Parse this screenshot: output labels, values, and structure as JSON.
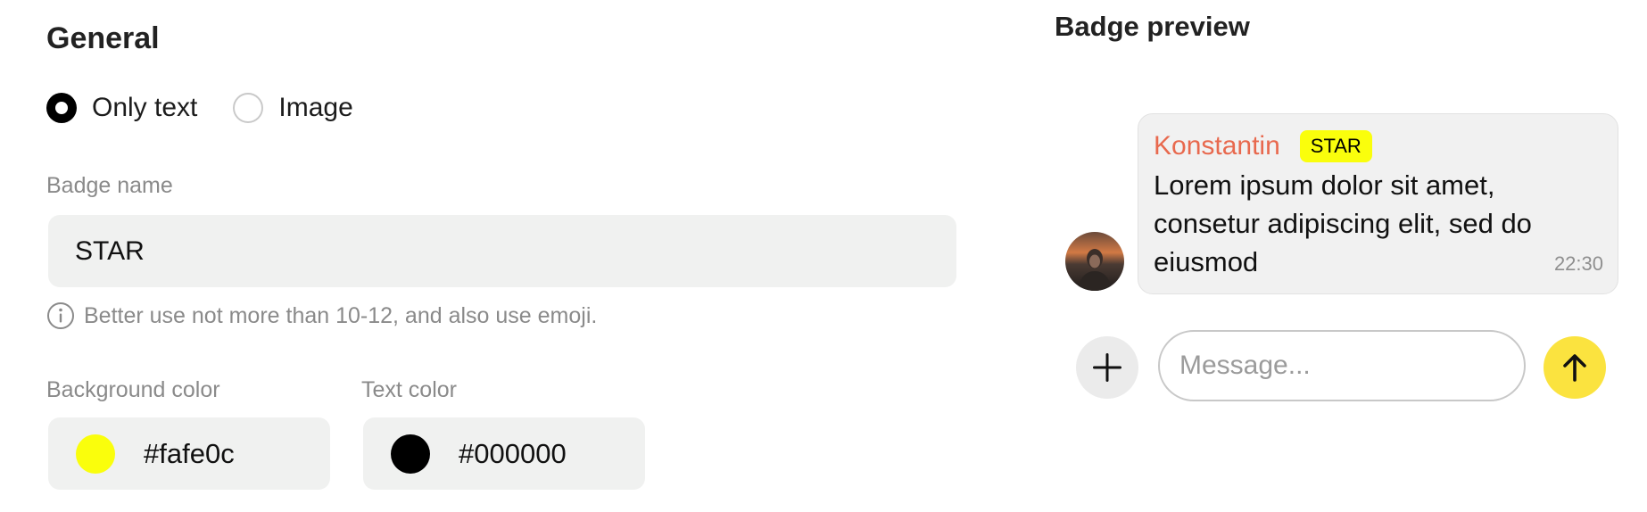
{
  "general": {
    "title": "General",
    "badge_type": {
      "options": [
        {
          "label": "Only text",
          "selected": true
        },
        {
          "label": "Image",
          "selected": false
        }
      ]
    },
    "badge_name": {
      "label": "Badge name",
      "value": "STAR",
      "hint": "Better use not more than 10-12, and also use emoji.",
      "hint_icon": "info-icon"
    },
    "background_color": {
      "label": "Background color",
      "value": "#fafe0c"
    },
    "text_color": {
      "label": "Text color",
      "value": "#000000"
    }
  },
  "preview": {
    "title": "Badge preview",
    "message": {
      "sender": "Konstantin",
      "sender_color": "#e8694e",
      "badge": "STAR",
      "text": "Lorem ipsum dolor sit amet, consetur adipiscing elit, sed do eiusmod",
      "time": "22:30"
    },
    "composer": {
      "placeholder": "Message...",
      "add_icon": "plus-icon",
      "send_icon": "arrow-up-icon",
      "send_color": "#fbe33f"
    }
  }
}
